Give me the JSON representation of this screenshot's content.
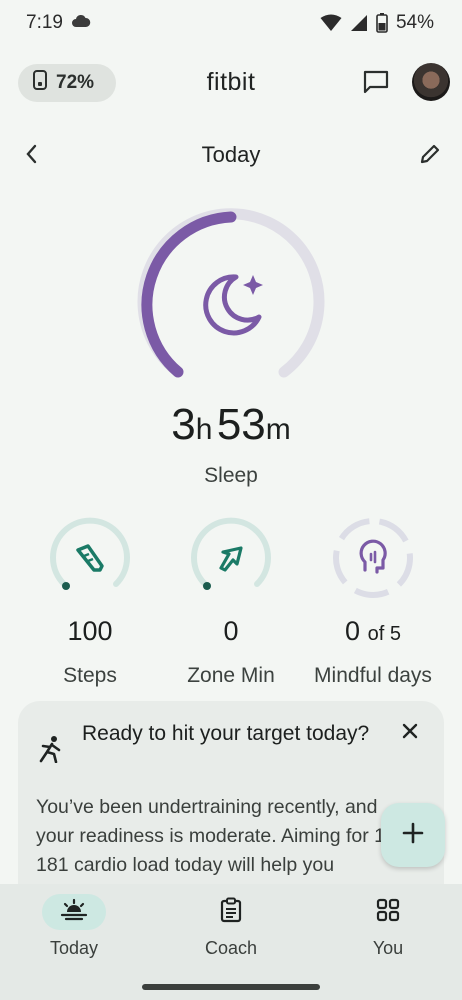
{
  "status_bar": {
    "time": "7:19",
    "battery": "54%"
  },
  "header": {
    "device_battery": "72%",
    "app_title": "fitbit",
    "icons": {
      "device": "watch-icon",
      "chat": "chat-icon",
      "avatar": "avatar"
    }
  },
  "date_nav": {
    "title": "Today"
  },
  "sleep": {
    "hours": "3",
    "hours_unit": "h",
    "minutes": "53",
    "minutes_unit": "m",
    "label": "Sleep",
    "ring_progress": 0.45,
    "color": "#7b5aa6"
  },
  "stats": [
    {
      "value": "100",
      "suffix": "",
      "label": "Steps",
      "icon": "shoe-icon"
    },
    {
      "value": "0",
      "suffix": "",
      "label": "Zone Min",
      "icon": "zone-arrow-icon"
    },
    {
      "value": "0",
      "suffix": "of 5",
      "label": "Mindful days",
      "icon": "mind-head-icon"
    }
  ],
  "card": {
    "title": "Ready to hit your target today?",
    "body": "You’ve been undertraining recently, and your readiness is moderate. Aiming for 115-181 cardio load today will help you",
    "icon": "running-person-icon"
  },
  "bottom_nav": [
    {
      "label": "Today",
      "icon": "sunrise-icon",
      "active": true
    },
    {
      "label": "Coach",
      "icon": "clipboard-icon",
      "active": false
    },
    {
      "label": "You",
      "icon": "grid-icon",
      "active": false
    }
  ],
  "colors": {
    "accent": "#1a7a66",
    "sleep": "#7b5aa6",
    "teal_ring": "#cfe3de"
  }
}
